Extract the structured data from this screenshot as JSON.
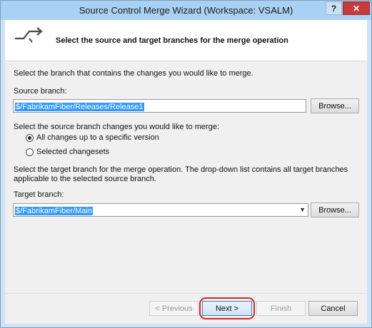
{
  "window": {
    "title": "Source Control Merge Wizard (Workspace: VSALM)",
    "help_label": "?",
    "close_label": "✕"
  },
  "banner": {
    "icon": "merge-arrow-icon",
    "heading": "Select the source and target branches for the merge operation"
  },
  "source": {
    "prompt": "Select the branch that contains the changes you would like to merge.",
    "label": "Source branch:",
    "value": "$/FabrikamFiber/Releases/Release1",
    "browse_label": "Browse..."
  },
  "changes": {
    "prompt": "Select the source branch changes you would like to merge:",
    "options": [
      {
        "label": "All changes up to a specific version",
        "selected": true
      },
      {
        "label": "Selected changesets",
        "selected": false
      }
    ]
  },
  "target": {
    "prompt": "Select the target branch for the merge operation.  The drop-down list contains all target branches applicable to the selected source branch.",
    "label": "Target branch:",
    "value": "$/FabrikamFiber/Main",
    "browse_label": "Browse..."
  },
  "footer": {
    "previous_label": "< Previous",
    "next_label": "Next >",
    "finish_label": "Finish",
    "cancel_label": "Cancel"
  },
  "colors": {
    "title_bar": "#a9d1f3",
    "close_button": "#c7393a",
    "selection": "#3399ff",
    "highlight": "#d8262a"
  }
}
